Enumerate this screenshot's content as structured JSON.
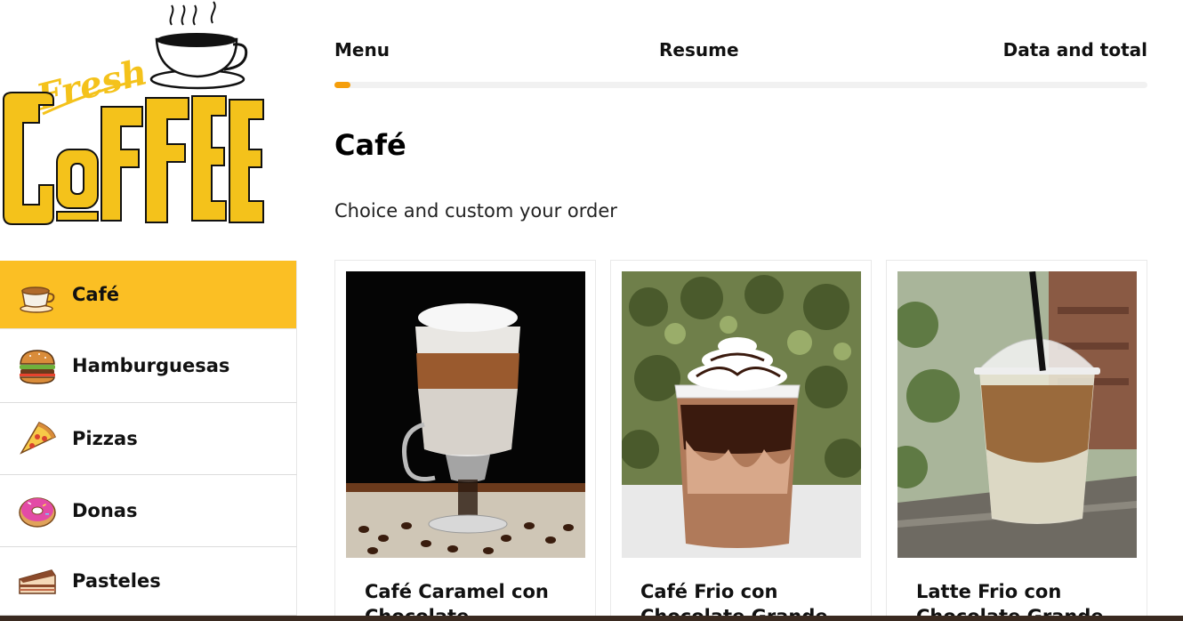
{
  "brand": {
    "logo_word_1": "Fresh",
    "logo_word_2": "COFFEE",
    "accent": "#fbbf24",
    "progress_color": "#f59e0b"
  },
  "sidebar": {
    "items": [
      {
        "label": "Café",
        "icon": "coffee-cup-icon",
        "active": true
      },
      {
        "label": "Hamburguesas",
        "icon": "hamburger-icon",
        "active": false
      },
      {
        "label": "Pizzas",
        "icon": "pizza-slice-icon",
        "active": false
      },
      {
        "label": "Donas",
        "icon": "donut-icon",
        "active": false
      },
      {
        "label": "Pasteles",
        "icon": "cake-slice-icon",
        "active": false
      }
    ]
  },
  "steps": {
    "items": [
      "Menu",
      "Resume",
      "Data and total"
    ],
    "progress": 0.02
  },
  "main": {
    "title": "Café",
    "subtitle": "Choice and custom your order"
  },
  "products": [
    {
      "name": "Café Caramel con Chocolate",
      "image": "layered-latte-glass-image"
    },
    {
      "name": "Café Frio con Chocolate Grande",
      "image": "chocolate-frappe-image"
    },
    {
      "name": "Latte Frio con Chocolate Grande",
      "image": "iced-latte-cup-image"
    }
  ]
}
